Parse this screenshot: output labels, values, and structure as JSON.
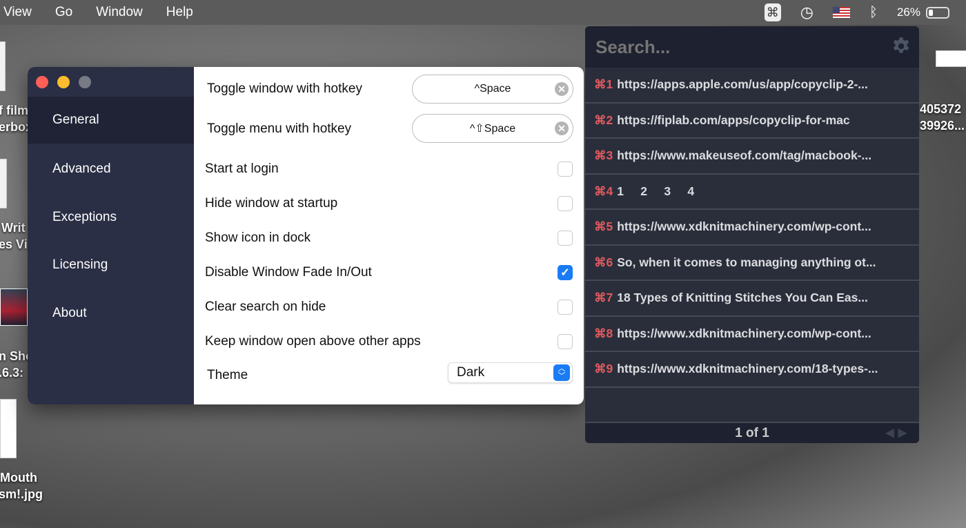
{
  "menubar": {
    "items": [
      "View",
      "Go",
      "Window",
      "Help"
    ],
    "battery": "26%",
    "icons": [
      "copyclip-icon",
      "time-machine-icon",
      "us-flag-icon",
      "bluetooth-icon",
      "battery-icon"
    ]
  },
  "desktop": {
    "labels": [
      "f film",
      "erbox",
      "Writ",
      "es Vi",
      "n Sho",
      ".6.3:",
      "Mouth",
      "sm!.jpg",
      "405372",
      "39926..."
    ]
  },
  "prefs": {
    "sidebar": [
      {
        "label": "General",
        "selected": true
      },
      {
        "label": "Advanced"
      },
      {
        "label": "Exceptions"
      },
      {
        "label": "Licensing"
      },
      {
        "label": "About"
      }
    ],
    "hotkeys": [
      {
        "label": "Toggle window with hotkey",
        "value": "^Space"
      },
      {
        "label": "Toggle menu with hotkey",
        "value": "^⇧Space"
      }
    ],
    "options": [
      {
        "label": "Start at login",
        "checked": false
      },
      {
        "label": "Hide window at startup",
        "checked": false
      },
      {
        "label": "Show icon in dock",
        "checked": false
      },
      {
        "label": "Disable Window Fade In/Out",
        "checked": true
      },
      {
        "label": "Clear search on hide",
        "checked": false
      },
      {
        "label": "Keep window open above other apps",
        "checked": false
      }
    ],
    "theme": {
      "label": "Theme",
      "value": "Dark"
    }
  },
  "clipboard": {
    "search_placeholder": "Search...",
    "items": [
      {
        "key": "⌘1",
        "text": "https://apps.apple.com/us/app/copyclip-2-..."
      },
      {
        "key": "⌘2",
        "text": "https://fiplab.com/apps/copyclip-for-mac"
      },
      {
        "key": "⌘3",
        "text": "https://www.makeuseof.com/tag/macbook-..."
      },
      {
        "key": "⌘4",
        "text": "1     2     3     4"
      },
      {
        "key": "⌘5",
        "text": "https://www.xdknitmachinery.com/wp-cont..."
      },
      {
        "key": "⌘6",
        "text": "So, when it comes to managing anything ot..."
      },
      {
        "key": "⌘7",
        "text": "18 Types of Knitting Stitches You Can Eas..."
      },
      {
        "key": "⌘8",
        "text": "https://www.xdknitmachinery.com/wp-cont..."
      },
      {
        "key": "⌘9",
        "text": "https://www.xdknitmachinery.com/18-types-..."
      }
    ],
    "pager": "1 of 1"
  },
  "colors": {
    "accent": "#1a7cf5",
    "key": "#e05a5f",
    "sidebar": "#2a2f45",
    "panel": "#2a2e3b"
  }
}
